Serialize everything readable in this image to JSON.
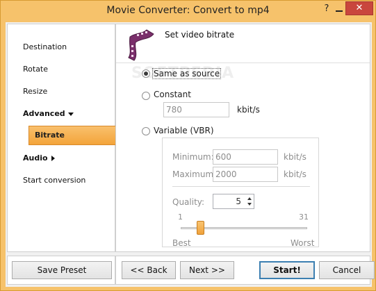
{
  "window": {
    "title": "Movie Converter:  Convert to mp4",
    "help": "?",
    "close": "✕"
  },
  "sidebar": {
    "items": [
      {
        "label": "Destination"
      },
      {
        "label": "Rotate"
      },
      {
        "label": "Resize"
      },
      {
        "label": "Advanced"
      },
      {
        "label": "Bitrate"
      },
      {
        "label": "Audio"
      },
      {
        "label": "Start conversion"
      }
    ]
  },
  "header": {
    "title": "Set video bitrate",
    "icon": "film-reel-icon"
  },
  "watermark": "SOFTPEDIA",
  "options": {
    "same_as_source": "Same as source",
    "constant": "Constant",
    "variable": "Variable (VBR)",
    "selected": "same_as_source"
  },
  "constant": {
    "value": "780",
    "unit": "kbit/s"
  },
  "vbr": {
    "min_label": "Minimum:",
    "min_value": "600",
    "max_label": "Maximum",
    "max_value": "2000",
    "unit": "kbit/s",
    "quality_label": "Quality:",
    "quality_value": "5",
    "slider_min": "1",
    "slider_max": "31",
    "slider_value": 5,
    "best_label": "Best",
    "worst_label": "Worst"
  },
  "buttons": {
    "save_preset": "Save Preset",
    "back": "<< Back",
    "next": "Next >>",
    "start": "Start!",
    "cancel": "Cancel"
  },
  "colors": {
    "accent": "#f3a43a",
    "titlebar": "#f6c26b",
    "close": "#c9463d",
    "primary_border": "#3c7fb1"
  }
}
